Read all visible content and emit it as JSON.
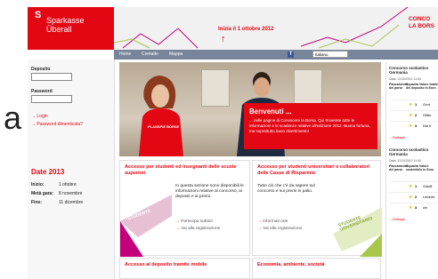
{
  "background_char": "a",
  "brand": {
    "symbol": "S",
    "line1": "Sparkasse",
    "line2": "Überall"
  },
  "banner": {
    "date_text": "Inizia il 1 ottobre 2012",
    "arrow": "↑",
    "concorso_line1": "CONCO",
    "concorso_line2": "LA BORS"
  },
  "nav": {
    "items": [
      "Home",
      "Contatto",
      "Mappa"
    ]
  },
  "language": {
    "value": "Italiano"
  },
  "login": {
    "deposito_label": "Deposito",
    "password_label": "Password",
    "login_link": "Login",
    "forgot_link": "Password dimenticata?"
  },
  "dates": {
    "title": "Date 2013",
    "rows": [
      {
        "label": "Inizio:",
        "value": "1 ottobre"
      },
      {
        "label": "Metà gara:",
        "value": "8 novembre"
      },
      {
        "label": "Fine:",
        "value": "11 dicembre"
      }
    ]
  },
  "hero": {
    "title": "Benvenuti ...",
    "body": "... nelle pagine di Conoscere la Borsa. Qui troverete tutte le informazioni e le scadenze relative all'edizione 2012. Buona fortuna, ma soprattutto buon divertimento!",
    "shirt_text": "PLANSPIE BÖRSE"
  },
  "boxes": [
    {
      "title": "Accesso per studenti ed insegnanti delle scuole superiori",
      "body": "In questa sezione sono disponibili le informazioni relative al concorso, ai depositi e ai premi.",
      "links": [
        "Partecipa subito!",
        "Vai alla registrazione"
      ],
      "tag": "STUDENTE"
    },
    {
      "title": "Accesso per studenti universitari e collaboratori delle Casse di Risparmio",
      "body": "Tutto ciò che c'è da sapere sul concorso e sui premi in palio.",
      "links": [
        "Informati ora!",
        "Vai alla registrazione"
      ],
      "tag": "STUDENTE UNIVERSITARIO"
    },
    {
      "title": "Accesso al deposito tramite mobile"
    },
    {
      "title": "Economia, ambiente, società"
    }
  ],
  "ranking": {
    "title": "Concorso scolastico Germania",
    "date": "Data: 11/10/2012 11:00",
    "headers": [
      "Piazzamento del parse",
      "Squadra Valore totale del deposito in Euro"
    ],
    "rows": [
      {
        "num": "1",
        "name": "Grof"
      },
      {
        "num": "2",
        "name": "Giffer"
      },
      {
        "num": "3",
        "name": "Die fi"
      }
    ],
    "details": "Dettagli",
    "title2": "Concorso scolastico Germania",
    "date2": "Data: 11/10/2012 11:00",
    "headers2": [
      "Piazzamento del parse",
      "Squadra Valore sostenibile in Euro"
    ],
    "rows2": [
      {
        "num": "1",
        "name": "Goldfi"
      },
      {
        "num": "2",
        "name": "Lebenb"
      },
      {
        "num": "3",
        "name": "wir"
      }
    ],
    "details2": "Dettagli"
  },
  "colors": {
    "brand_red": "#e30613",
    "nav": "#77849a",
    "magenta": "#c4007a",
    "lime": "#a7c74a"
  }
}
